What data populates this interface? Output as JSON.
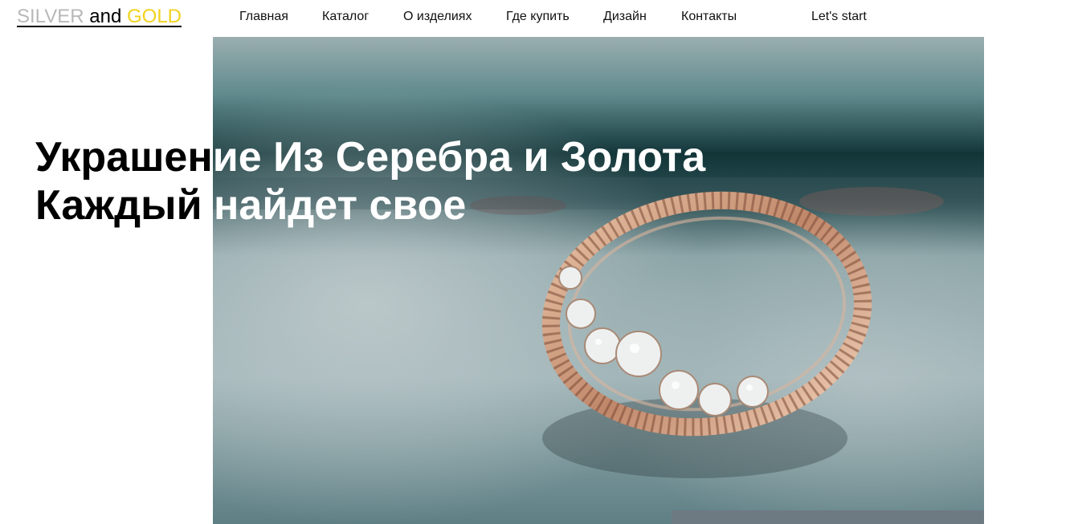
{
  "logo": {
    "silver": "SILVER",
    "and": " and ",
    "gold": "GOLD",
    "colors": {
      "silver": "#b8b8b8",
      "and": "#000000",
      "gold": "#f2d21d"
    }
  },
  "nav": {
    "items": [
      {
        "label": "Главная"
      },
      {
        "label": "Каталог"
      },
      {
        "label": "О изделиях"
      },
      {
        "label": "Где купить"
      },
      {
        "label": "Дизайн"
      },
      {
        "label": "Контакты"
      }
    ],
    "cta": "Let's start"
  },
  "hero": {
    "image": "ring-with-diamonds-photo",
    "headline_line1_a": "Украшен",
    "headline_line1_b": "ие Из Серебра и Золота",
    "headline_line2_a": "Каждый ",
    "headline_line2_b": "найдет свое"
  }
}
